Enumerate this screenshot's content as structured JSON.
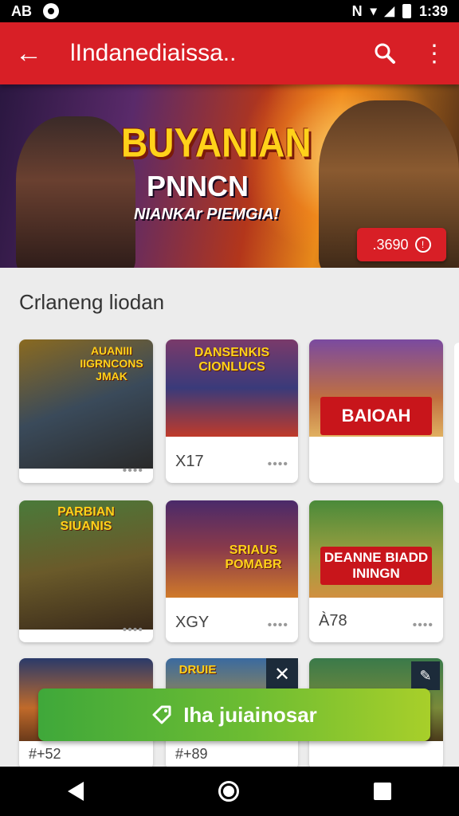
{
  "status_bar": {
    "left_text": "AB",
    "time": "1:39"
  },
  "app_bar": {
    "title": "lIndanediaissa..",
    "back_glyph": "←",
    "search_glyph": "⚲",
    "menu_glyph": "⋮"
  },
  "banner": {
    "title": "BUYANIAN",
    "subtitle": "PNNCN",
    "tagline": "NIANKAr PIEMGIA!",
    "badge": ".3690"
  },
  "section_title": "Crlaneng liodan",
  "cards": [
    {
      "thumb_label": "AUANIII\nIIGRNCONS\nJMAK",
      "meta": "",
      "dots": "••••"
    },
    {
      "thumb_label": "DANSENKIS\nCIONLUCS",
      "meta": "X17",
      "dots": "••••"
    },
    {
      "thumb_label": "BAIOAH",
      "meta": "",
      "dots": ""
    },
    {
      "thumb_label": "PARBIAN\nSIUANIS",
      "meta": "",
      "dots": "••••"
    },
    {
      "thumb_label": "SRIAUS\nPOMABR",
      "meta": "XGY",
      "dots": "••••"
    },
    {
      "thumb_label": "DEANNE BIADD\nININGN",
      "meta": "À78",
      "dots": "••••"
    },
    {
      "thumb_label": "",
      "meta": "#+52",
      "dots": ""
    },
    {
      "thumb_label": "DRUIE",
      "meta": "#+89",
      "dots": ""
    },
    {
      "thumb_label": "",
      "meta": "",
      "dots": ""
    }
  ],
  "overlay": {
    "close_glyph": "✕",
    "edit_glyph": "✎"
  },
  "cta": {
    "label": "Iha juiainosar",
    "icon": "tag-icon"
  },
  "colors": {
    "primary": "#d81f26",
    "cta_start": "#3fa83a",
    "cta_end": "#a8cf2a",
    "banner_gold": "#ffd21a"
  }
}
